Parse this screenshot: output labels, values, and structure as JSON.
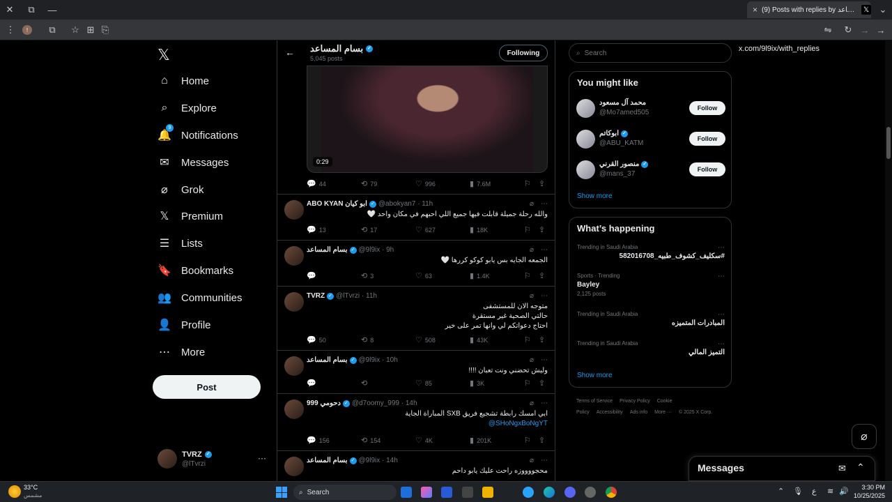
{
  "browser": {
    "tab_title": "(9) Posts with replies by بسام المساعد",
    "tab_close": "×",
    "new_tab": "+",
    "url": "x.com/9l9ix/with_replies",
    "window_buttons": {
      "close": "✕",
      "restore": "⧉",
      "minimize": "—"
    }
  },
  "sidebar": {
    "logo": "𝕏",
    "notifications_badge": "9",
    "items": [
      {
        "label": "Home",
        "icon": "home-icon",
        "glyph": "⌂"
      },
      {
        "label": "Explore",
        "icon": "search-icon",
        "glyph": "⌕"
      },
      {
        "label": "Notifications",
        "icon": "bell-icon",
        "glyph": "🔔"
      },
      {
        "label": "Messages",
        "icon": "mail-icon",
        "glyph": "✉"
      },
      {
        "label": "Grok",
        "icon": "grok-icon",
        "glyph": "⌀"
      },
      {
        "label": "Premium",
        "icon": "x-premium-icon",
        "glyph": "𝕏"
      },
      {
        "label": "Lists",
        "icon": "list-icon",
        "glyph": "☰"
      },
      {
        "label": "Bookmarks",
        "icon": "bookmark-icon",
        "glyph": "🔖"
      },
      {
        "label": "Communities",
        "icon": "communities-icon",
        "glyph": "👥"
      },
      {
        "label": "Profile",
        "icon": "profile-icon",
        "glyph": "👤"
      },
      {
        "label": "More",
        "icon": "more-circle-icon",
        "glyph": "⋯"
      }
    ],
    "post_label": "Post",
    "account": {
      "name": "TVRZ",
      "handle": "@lTvrzi",
      "more": "···"
    }
  },
  "header": {
    "back": "←",
    "name": "بسام المساعد",
    "posts_count": "5,045 posts",
    "following_label": "Following"
  },
  "media_post": {
    "duration": "0:29",
    "replies": "44",
    "reposts": "79",
    "likes": "996",
    "views": "7.6M"
  },
  "tweets": [
    {
      "name": "ABO KYAN ابو كيان",
      "meta": "@abokyan7 · 11h",
      "lines": [
        "والله رحلة جميلة قابلت فيها جميع اللي احبهم في مكان واحد 🤍"
      ],
      "replies": "13",
      "reposts": "17",
      "likes": "627",
      "views": "18K"
    },
    {
      "name": "بسام المساعد",
      "meta": "@9l9ix · 9h",
      "lines": [
        "الجمعه الجايه بس يابو كوكو كررها 🤍"
      ],
      "replies": "",
      "reposts": "3",
      "likes": "63",
      "views": "1.4K"
    },
    {
      "name": "TVRZ",
      "meta": "@lTvrzi · 11h",
      "lines": [
        "متوجه الان للمستشفى",
        "حالتي الصحية غير مستقرة",
        "احتاج دعواتكم لي وانها تمر على خير"
      ],
      "replies": "50",
      "reposts": "8",
      "likes": "508",
      "views": "43K"
    },
    {
      "name": "بسام المساعد",
      "meta": "@9l9ix · 10h",
      "lines": [
        "وليش تحضني ونت تعبان !!!!"
      ],
      "replies": "",
      "reposts": "",
      "likes": "85",
      "views": "3K"
    },
    {
      "name": "999 دحومي",
      "meta": "@d7oomy_999 · 14h",
      "lines": [
        "ابي امسك رابطة تشجيع فريق SXB المباراة الجاية"
      ],
      "link": "@SHoNgxBoNgYT",
      "replies": "156",
      "reposts": "154",
      "likes": "4K",
      "views": "201K"
    },
    {
      "name": "بسام المساعد",
      "meta": "@9l9ix · 14h",
      "lines": [
        "محجووووزه راحت عليك يابو داحم"
      ]
    }
  ],
  "right": {
    "search_placeholder": "Search",
    "you_might_like": {
      "title": "You might like",
      "people": [
        {
          "name": "محمد آل مسعود",
          "handle": "@Mo7amed505",
          "verified": false
        },
        {
          "name": "ابوكاتم",
          "handle": "@ABU_KATM",
          "verified": true
        },
        {
          "name": "منصور القرني",
          "handle": "@mans_37",
          "verified": true
        }
      ],
      "follow_label": "Follow",
      "show_more": "Show more"
    },
    "whats_happening": {
      "title": "What’s happening",
      "trends": [
        {
          "context": "Trending in Saudi Arabia",
          "title": "#سكليف_كشوف_طبيه_582016708",
          "count": ""
        },
        {
          "context": "Sports · Trending",
          "title": "Bayley",
          "count": "2,125 posts"
        },
        {
          "context": "Trending in Saudi Arabia",
          "title": "المبادرات المتميزه",
          "count": ""
        },
        {
          "context": "Trending in Saudi Arabia",
          "title": "التميز المالي",
          "count": ""
        }
      ],
      "show_more": "Show more"
    },
    "footer": [
      "Terms of Service",
      "Privacy Policy",
      "Cookie Policy",
      "Accessibility",
      "Ads info",
      "More ···",
      "© 2025 X Corp."
    ]
  },
  "messages_drawer": {
    "title": "Messages"
  },
  "taskbar": {
    "weather_temp": "33°C",
    "weather_desc": "مشمس",
    "search_label": "Search",
    "lang": "ع",
    "time": "3:30 PM",
    "date": "10/25/2025"
  },
  "colors": {
    "accent": "#1d9bf0",
    "background": "#000000",
    "border": "#2f3336",
    "muted": "#71767b"
  }
}
